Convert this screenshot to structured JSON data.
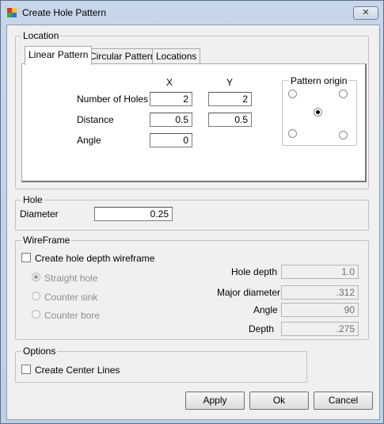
{
  "window": {
    "title": "Create Hole Pattern",
    "close_glyph": "✕"
  },
  "location": {
    "label": "Location",
    "tabs": [
      {
        "label": "Linear Pattern",
        "active": true
      },
      {
        "label": "Circular Pattern",
        "active": false
      },
      {
        "label": "Locations",
        "active": false
      }
    ],
    "col_x": "X",
    "col_y": "Y",
    "number_of_holes": {
      "label": "Number of Holes",
      "x": "2",
      "y": "2"
    },
    "distance": {
      "label": "Distance",
      "x": "0.5",
      "y": "0.5"
    },
    "angle": {
      "label": "Angle",
      "value": "0"
    },
    "pattern_origin": {
      "label": "Pattern origin",
      "selected": "center"
    }
  },
  "hole": {
    "label": "Hole",
    "diameter_label": "Diameter",
    "diameter_value": "0.25"
  },
  "wireframe": {
    "label": "WireFrame",
    "create_depth_label": "Create hole depth wireframe",
    "create_depth_checked": false,
    "options": [
      {
        "label": "Straight hole",
        "checked": true
      },
      {
        "label": "Counter sink",
        "checked": false
      },
      {
        "label": "Counter bore",
        "checked": false
      }
    ],
    "hole_depth": {
      "label": "Hole depth",
      "value": "1.0"
    },
    "major_diameter": {
      "label": "Major diameter",
      "value": ".312"
    },
    "angle": {
      "label": "Angle",
      "value": "90"
    },
    "depth": {
      "label": "Depth",
      "value": ".275"
    }
  },
  "options": {
    "label": "Options",
    "center_lines_label": "Create Center Lines",
    "center_lines_checked": false
  },
  "buttons": {
    "apply": "Apply",
    "ok": "Ok",
    "cancel": "Cancel"
  },
  "colors": {
    "titlebar": "#c7d6e8",
    "dialog_bg": "#f0f0f0",
    "border": "#5a6f8a"
  }
}
